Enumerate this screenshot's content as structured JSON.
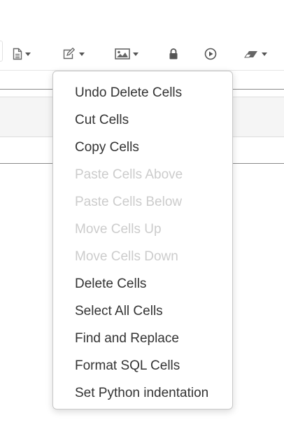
{
  "toolbar": {
    "buttons": [
      {
        "name": "document-icon",
        "has_dropdown": true
      },
      {
        "name": "edit-icon",
        "has_dropdown": true
      },
      {
        "name": "image-icon",
        "has_dropdown": true
      },
      {
        "name": "lock-icon",
        "has_dropdown": false
      },
      {
        "name": "play-icon",
        "has_dropdown": false
      },
      {
        "name": "eraser-icon",
        "has_dropdown": true
      }
    ]
  },
  "menu": {
    "items": [
      {
        "label": "Undo Delete Cells",
        "enabled": true
      },
      {
        "label": "Cut Cells",
        "enabled": true
      },
      {
        "label": "Copy Cells",
        "enabled": true
      },
      {
        "label": "Paste Cells Above",
        "enabled": false
      },
      {
        "label": "Paste Cells Below",
        "enabled": false
      },
      {
        "label": "Move Cells Up",
        "enabled": false
      },
      {
        "label": "Move Cells Down",
        "enabled": false
      },
      {
        "label": "Delete Cells",
        "enabled": true
      },
      {
        "label": "Select All Cells",
        "enabled": true
      },
      {
        "label": "Find and Replace",
        "enabled": true
      },
      {
        "label": "Format SQL Cells",
        "enabled": true
      },
      {
        "label": "Set Python indentation",
        "enabled": true
      }
    ]
  },
  "colors": {
    "text": "#333333",
    "disabled_text": "#cccccc",
    "icon": "#666666",
    "menu_border": "#c8c8c8"
  }
}
